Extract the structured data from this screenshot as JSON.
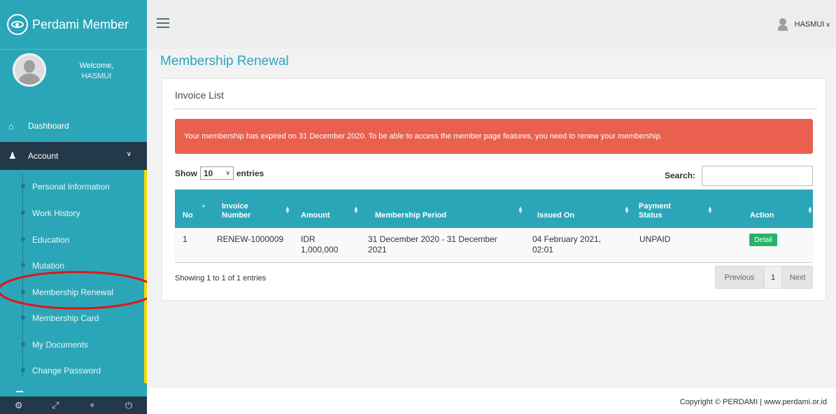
{
  "brand": {
    "title": "Perdami Member"
  },
  "profile": {
    "welcome": "Welcome,",
    "name": "HASMUI"
  },
  "nav": {
    "dashboard": {
      "label": "Dashboard",
      "icon": "home-icon"
    },
    "account": {
      "label": "Account",
      "icon": "user-icon"
    },
    "account_items": [
      {
        "label": "Personal Information"
      },
      {
        "label": "Work History"
      },
      {
        "label": "Education"
      },
      {
        "label": "Mutation"
      },
      {
        "label": "Membership Renewal"
      },
      {
        "label": "Membership Card"
      },
      {
        "label": "My Documents"
      },
      {
        "label": "Change Password"
      }
    ]
  },
  "sidebar_footer": {
    "icons": [
      "settings-icon",
      "fullscreen-icon",
      "eye-slash-icon",
      "power-icon"
    ]
  },
  "topbar": {
    "user_name": "HASMUI"
  },
  "page": {
    "title": "Membership Renewal"
  },
  "panel": {
    "title": "Invoice List",
    "alert": "Your membership has expired on 31 December 2020. To be able to access the member page features, you need to renew your membership."
  },
  "table_controls": {
    "show_label": "Show",
    "entries_value": "10",
    "entries_label": "entries",
    "search_label": "Search:",
    "search_value": ""
  },
  "table": {
    "columns": [
      "No",
      "Invoice Number",
      "Amount",
      "Membership Period",
      "Issued On",
      "Payment Status",
      "Action"
    ],
    "rows": [
      {
        "no": "1",
        "invoice_number": "RENEW-1000009",
        "amount": "IDR 1,000,000",
        "membership_period": "31 December 2020 - 31 December 2021",
        "issued_on": "04 February 2021, 02:01",
        "payment_status": "UNPAID",
        "action": "Detail"
      }
    ]
  },
  "table_footer": {
    "showing": "Showing 1 to 1 of 1 entries",
    "prev": "Previous",
    "page": "1",
    "next": "Next"
  },
  "footer": {
    "text": "Copyright © PERDAMI | www.perdami.or.id"
  },
  "colors": {
    "primary": "#2ba6b8",
    "sidebar_active": "#23394a",
    "alert": "#e9604f",
    "detail_button": "#27b36a",
    "highlight": "#f5d800"
  }
}
